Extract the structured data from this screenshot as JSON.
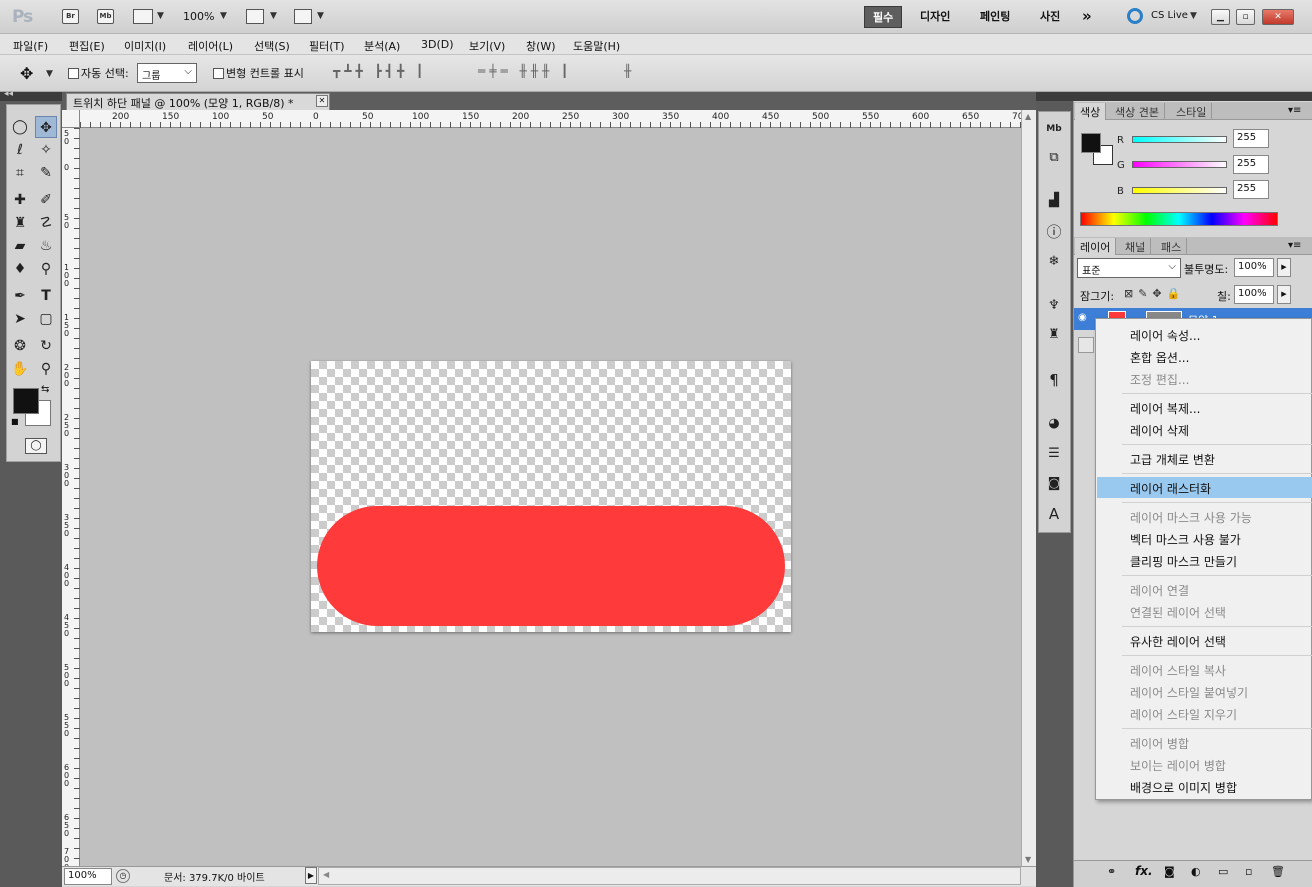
{
  "app": {
    "logo": "Ps",
    "bridge_label": "Br",
    "minibridge_label": "Mb",
    "zoom_level": "100%",
    "workspaces": [
      "필수",
      "디자인",
      "페인팅",
      "사진"
    ],
    "more_workspaces": "»",
    "cs_live": "CS Live",
    "accent_color": "#5e5e5e"
  },
  "menu": [
    "파일(F)",
    "편집(E)",
    "이미지(I)",
    "레이어(L)",
    "선택(S)",
    "필터(T)",
    "분석(A)",
    "3D(D)",
    "보기(V)",
    "창(W)",
    "도움말(H)"
  ],
  "options": {
    "auto_select_label": "자동 선택:",
    "auto_select_value": "그룹",
    "transform_controls_label": "변형 컨트롤 표시"
  },
  "document": {
    "tab_title": "트위치 하단 패널 @ 100% (모양 1, RGB/8) *",
    "ruler_h": [
      "200",
      "150",
      "100",
      "50",
      "0",
      "50",
      "100",
      "150",
      "200",
      "250",
      "300",
      "350",
      "400",
      "450",
      "500",
      "550",
      "600",
      "650",
      "70"
    ],
    "ruler_v": [
      "50",
      "0",
      "50",
      "100",
      "150",
      "200",
      "250",
      "300",
      "350",
      "400",
      "450",
      "500",
      "550",
      "600",
      "650",
      "700"
    ],
    "shape_color": "#ff3a3a"
  },
  "status": {
    "zoom": "100%",
    "doc_info": "문서: 379.7K/0 바이트"
  },
  "color_panel": {
    "tabs": [
      "색상",
      "색상 견본",
      "스타일"
    ],
    "channels": [
      {
        "label": "R",
        "value": "255"
      },
      {
        "label": "G",
        "value": "255"
      },
      {
        "label": "B",
        "value": "255"
      }
    ]
  },
  "layers_panel": {
    "tabs": [
      "레이어",
      "채널",
      "패스"
    ],
    "blend_mode": "표준",
    "opacity_label": "불투명도:",
    "opacity_value": "100%",
    "lock_label": "잠그기:",
    "fill_label": "칠:",
    "fill_value": "100%",
    "layer_name": "모양 1"
  },
  "context_menu": {
    "groups": [
      [
        {
          "label": "레이어 속성...",
          "enabled": true
        },
        {
          "label": "혼합 옵션...",
          "enabled": true
        },
        {
          "label": "조정 편집...",
          "enabled": false
        }
      ],
      [
        {
          "label": "레이어 복제...",
          "enabled": true
        },
        {
          "label": "레이어 삭제",
          "enabled": true
        }
      ],
      [
        {
          "label": "고급 개체로 변환",
          "enabled": true
        }
      ],
      [
        {
          "label": "레이어 래스터화",
          "enabled": true,
          "highlighted": true
        }
      ],
      [
        {
          "label": "레이어 마스크 사용 가능",
          "enabled": false
        },
        {
          "label": "벡터 마스크 사용 불가",
          "enabled": true
        },
        {
          "label": "클리핑 마스크 만들기",
          "enabled": true
        }
      ],
      [
        {
          "label": "레이어 연결",
          "enabled": false
        },
        {
          "label": "연결된 레이어 선택",
          "enabled": false
        }
      ],
      [
        {
          "label": "유사한 레이어 선택",
          "enabled": true
        }
      ],
      [
        {
          "label": "레이어 스타일 복사",
          "enabled": false
        },
        {
          "label": "레이어 스타일 붙여넣기",
          "enabled": false
        },
        {
          "label": "레이어 스타일 지우기",
          "enabled": false
        }
      ],
      [
        {
          "label": "레이어 병합",
          "enabled": false
        },
        {
          "label": "보이는 레이어 병합",
          "enabled": false
        },
        {
          "label": "배경으로 이미지 병합",
          "enabled": true
        }
      ]
    ]
  }
}
